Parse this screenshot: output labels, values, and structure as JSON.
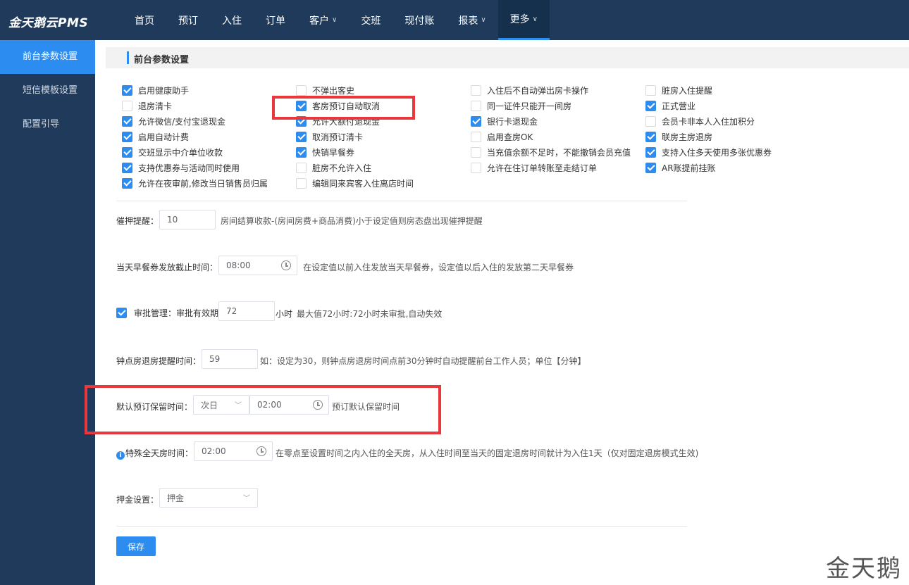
{
  "app": {
    "logo": "金天鹅云PMS"
  },
  "nav": [
    {
      "label": "首页",
      "dropdown": false,
      "active": false
    },
    {
      "label": "预订",
      "dropdown": false,
      "active": false
    },
    {
      "label": "入住",
      "dropdown": false,
      "active": false
    },
    {
      "label": "订单",
      "dropdown": false,
      "active": false
    },
    {
      "label": "客户",
      "dropdown": true,
      "active": false
    },
    {
      "label": "交班",
      "dropdown": false,
      "active": false
    },
    {
      "label": "现付账",
      "dropdown": false,
      "active": false
    },
    {
      "label": "报表",
      "dropdown": true,
      "active": false
    },
    {
      "label": "更多",
      "dropdown": true,
      "active": true
    }
  ],
  "sidebar": [
    {
      "label": "前台参数设置",
      "active": true
    },
    {
      "label": "短信模板设置",
      "active": false
    },
    {
      "label": "配置引导",
      "active": false
    }
  ],
  "section_title": "前台参数设置",
  "checkbox_columns": [
    [
      {
        "label": "启用健康助手",
        "checked": true
      },
      {
        "label": "退房清卡",
        "checked": false
      },
      {
        "label": "允许微信/支付宝退现金",
        "checked": true
      },
      {
        "label": "启用自动计费",
        "checked": true
      },
      {
        "label": "交班显示中介单位收款",
        "checked": true
      },
      {
        "label": "支持优惠券与活动同时使用",
        "checked": true
      },
      {
        "label": "允许在夜审前,修改当日销售员归属",
        "checked": true
      }
    ],
    [
      {
        "label": "不弹出客史",
        "checked": false
      },
      {
        "label": "客房预订自动取消",
        "checked": true
      },
      {
        "label": "允许大额付退现金",
        "checked": true
      },
      {
        "label": "取消预订清卡",
        "checked": true
      },
      {
        "label": "快销早餐券",
        "checked": true
      },
      {
        "label": "脏房不允许入住",
        "checked": false
      },
      {
        "label": "编辑同来宾客入住离店时间",
        "checked": false
      }
    ],
    [
      {
        "label": "入住后不自动弹出房卡操作",
        "checked": false
      },
      {
        "label": "同一证件只能开一间房",
        "checked": false
      },
      {
        "label": "银行卡退现金",
        "checked": true
      },
      {
        "label": "启用查房OK",
        "checked": false
      },
      {
        "label": "当充值余额不足时，不能撤销会员充值",
        "checked": false
      },
      {
        "label": "允许在住订单转账至走结订单",
        "checked": false
      }
    ],
    [
      {
        "label": "脏房入住提醒",
        "checked": false
      },
      {
        "label": "正式营业",
        "checked": true
      },
      {
        "label": "会员卡非本人入住加积分",
        "checked": false
      },
      {
        "label": "联房主房退房",
        "checked": true
      },
      {
        "label": "支持入住多天使用多张优惠券",
        "checked": true
      },
      {
        "label": "AR账提前挂账",
        "checked": true
      }
    ]
  ],
  "settings": {
    "dunning": {
      "label": "催押提醒：",
      "value": "10",
      "hint": "房间结算收款-(房间房费+商品消费)小于设定值则房态盘出现催押提醒"
    },
    "breakfast": {
      "label": "当天早餐券发放截止时间：",
      "value": "08:00",
      "hint": "在设定值以前入住发放当天早餐券，设定值以后入住的发放第二天早餐券"
    },
    "approval": {
      "label": "审批管理：",
      "sub_label": "审批有效期",
      "checked": true,
      "value": "72",
      "unit": "小时",
      "hint": "最大值72小时:72小时未审批,自动失效"
    },
    "hourly": {
      "label": "钟点房退房提醒时间：",
      "value": "59",
      "hint": "如：设定为30，则钟点房退房时间点前30分钟时自动提醒前台工作人员；单位【分钟】"
    },
    "reserve": {
      "label": "默认预订保留时间：",
      "day_value": "次日",
      "time_value": "02:00",
      "hint": "预订默认保留时间"
    },
    "fullday": {
      "label": "特殊全天房时间：",
      "value": "02:00",
      "hint": "在零点至设置时间之内入住的全天房，从入住时间至当天的固定退房时间就计为入住1天（仅对固定退房模式生效)"
    },
    "deposit": {
      "label": "押金设置：",
      "value": "押金"
    }
  },
  "save_label": "保存",
  "watermark": "金天鹅",
  "colors": {
    "primary": "#2d8cf0",
    "nav_bg": "#1f3a5a",
    "highlight": "#e8383d"
  }
}
